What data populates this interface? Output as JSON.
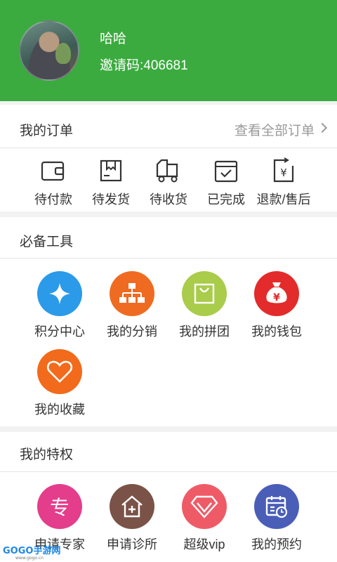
{
  "profile": {
    "name": "哈哈",
    "invite_code": "邀请码:406681"
  },
  "orders": {
    "title": "我的订单",
    "view_all": "查看全部订单",
    "items": [
      {
        "label": "待付款",
        "icon": "wallet-icon"
      },
      {
        "label": "待发货",
        "icon": "package-icon"
      },
      {
        "label": "待收货",
        "icon": "truck-icon"
      },
      {
        "label": "已完成",
        "icon": "checked-box-icon"
      },
      {
        "label": "退款/售后",
        "icon": "refund-icon"
      }
    ]
  },
  "tools": {
    "title": "必备工具",
    "items": [
      {
        "label": "积分中心",
        "icon": "star-diamond-icon",
        "color": "#2b9ae8"
      },
      {
        "label": "我的分销",
        "icon": "network-icon",
        "color": "#ef6b21"
      },
      {
        "label": "我的拼团",
        "icon": "shopping-bag-icon",
        "color": "#a9cc4b"
      },
      {
        "label": "我的钱包",
        "icon": "money-bag-icon",
        "color": "#e32b2b"
      },
      {
        "label": "我的收藏",
        "icon": "heart-icon",
        "color": "#f26a1b"
      }
    ]
  },
  "privileges": {
    "title": "我的特权",
    "items": [
      {
        "label": "申请专家",
        "icon": "expert-icon",
        "color": "#e43d8c",
        "glyph": "专"
      },
      {
        "label": "申请诊所",
        "icon": "clinic-icon",
        "color": "#7b5247"
      },
      {
        "label": "超级vip",
        "icon": "diamond-icon",
        "color": "#ef5a67"
      },
      {
        "label": "我的预约",
        "icon": "calendar-icon",
        "color": "#4a5eb8"
      }
    ]
  },
  "watermark": {
    "brand": "GOGO手游网",
    "url": "www.gogo.cn"
  }
}
